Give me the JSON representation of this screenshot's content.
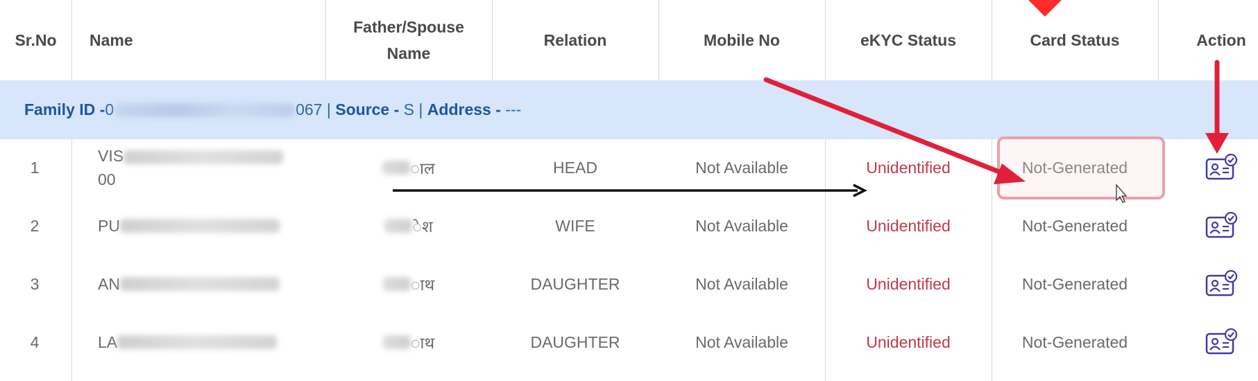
{
  "columns": [
    "Sr.No",
    "Name",
    "Father/Spouse Name",
    "Relation",
    "Mobile No",
    "eKYC Status",
    "Card Status",
    "Action"
  ],
  "family": {
    "family_id_label": "Family ID - ",
    "family_id_prefix": "0",
    "family_id_suffix": "067",
    "sep1": " | ",
    "source_label": "Source - ",
    "source_value": "S",
    "sep2": " | ",
    "address_label": "Address - ",
    "address_value": "---"
  },
  "rows": [
    {
      "sr": "1",
      "name_prefix": "VIS",
      "name_suffix": "00",
      "father_suffix": "ाल",
      "relation": "HEAD",
      "mobile": "Not Available",
      "ekyc": "Unidentified",
      "card": "Not-Generated"
    },
    {
      "sr": "2",
      "name_prefix": "PU",
      "name_suffix": "",
      "father_suffix": "ेश",
      "relation": "WIFE",
      "mobile": "Not Available",
      "ekyc": "Unidentified",
      "card": "Not-Generated"
    },
    {
      "sr": "3",
      "name_prefix": "AN",
      "name_suffix": "",
      "father_suffix": "ाथ",
      "relation": "DAUGHTER",
      "mobile": "Not Available",
      "ekyc": "Unidentified",
      "card": "Not-Generated"
    },
    {
      "sr": "4",
      "name_prefix": "LA",
      "name_suffix": "",
      "father_suffix": "ाथ",
      "relation": "DAUGHTER",
      "mobile": "Not Available",
      "ekyc": "Unidentified",
      "card": "Not-Generated"
    }
  ],
  "colors": {
    "accent_blue": "#1f56a0",
    "band_bg": "#d7e6fa",
    "status_red": "#c23a4a",
    "annotation_red": "#e0203a"
  },
  "icons": {
    "action": "id-card-verify-icon",
    "cursor": "mouse-pointer-icon"
  }
}
